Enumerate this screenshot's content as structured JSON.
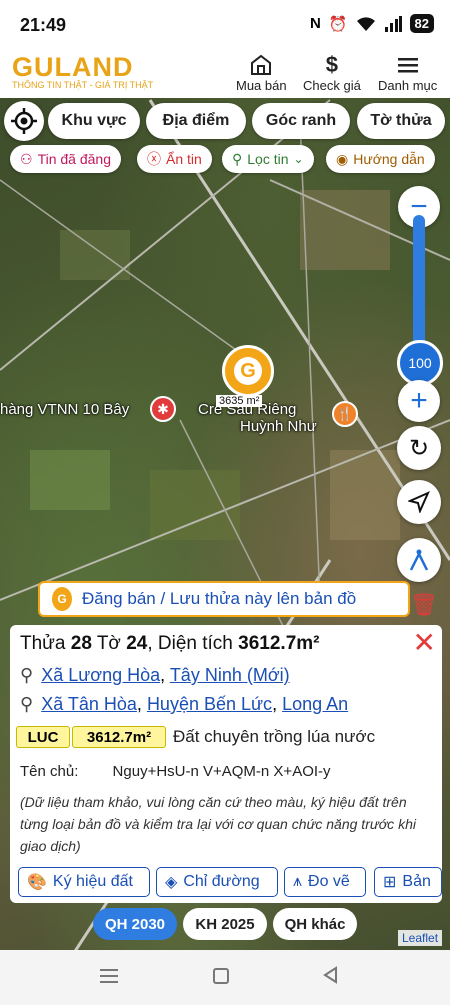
{
  "status": {
    "time": "21:49",
    "battery": "82"
  },
  "header": {
    "logo_text": "GULAND",
    "logo_slogan": "THÔNG TIN THẬT - GIÁ TRỊ THẬT",
    "mua_ban": "Mua bán",
    "check_gia": "Check giá",
    "danh_muc": "Danh mục"
  },
  "filters": {
    "khu_vuc": "Khu vực",
    "dia_diem": "Địa điểm",
    "goc_ranh": "Góc ranh",
    "to_thua": "Tờ thửa"
  },
  "chips": {
    "tin_da_dang": "Tin đã đăng",
    "an_tin": "Ẩn tin",
    "loc_tin": "Lọc tin",
    "huong_dan": "Hướng dẫn"
  },
  "zoom": {
    "value": "100",
    "level": 0.92
  },
  "map_labels": {
    "store": "hàng VTNN 10 Bây",
    "cafe_line1": "Crê Sầu Riêng",
    "cafe_line2": "Huỳnh Như",
    "marker_area": "3635 m²"
  },
  "save_banner": "Đăng bán / Lưu thửa này lên bản đồ",
  "parcel": {
    "thua_label": "Thửa",
    "thua": "28",
    "to_label": "Tờ",
    "to": "24",
    "dien_tich_label": "Diện tích",
    "dien_tich": "3612.7m²",
    "new_commune": "Xã Lương Hòa",
    "new_province": "Tây Ninh (Mới)",
    "old_commune": "Xã Tân Hòa",
    "old_district": "Huyện Bến Lức",
    "old_province": "Long An",
    "land_code": "LUC",
    "land_area": "3612.7m²",
    "land_type": "Đất chuyên trồng lúa nước",
    "owner_label": "Tên chủ:",
    "owner_value": "Nguy+HsU-n V+AQM-n X+AOI-y",
    "note": "(Dữ liệu tham khảo, vui lòng căn cứ theo màu, ký hiệu đất trên từng loại bản đồ và kiểm tra lại với cơ quan chức năng trước khi giao dịch)"
  },
  "actions": {
    "ky_hieu_dat": "Ký hiệu đất",
    "chi_duong": "Chỉ đường",
    "do_ve": "Đo vẽ",
    "bang": "Bản"
  },
  "plan_tabs": {
    "qh2030": "QH 2030",
    "kh2025": "KH 2025",
    "qh_khac": "QH khác"
  },
  "attribution": "Leaflet",
  "colors": {
    "brand": "#f2a516",
    "link": "#1a4fb5",
    "close": "#e23b3b",
    "active_tab": "#2f7de1"
  }
}
